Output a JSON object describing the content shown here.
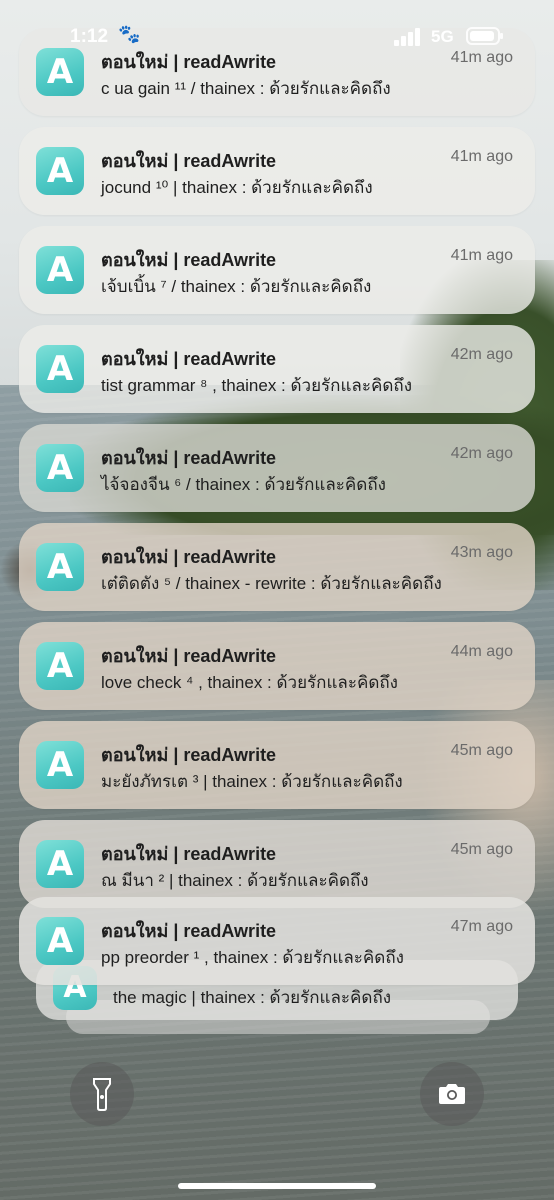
{
  "status_bar": {
    "time": "1:12",
    "network": "5G"
  },
  "notifications": [
    {
      "app": "ตอนใหม่ | readAwrite",
      "age": "41m ago",
      "message": "c ua gain ¹¹ / thainex : ด้วยรักและคิดถึง"
    },
    {
      "app": "ตอนใหม่ | readAwrite",
      "age": "41m ago",
      "message": "jocund ¹⁰  | thainex : ด้วยรักและคิดถึง"
    },
    {
      "app": "ตอนใหม่ | readAwrite",
      "age": "41m ago",
      "message": "เจ้บเบิ้น ⁷ / thainex : ด้วยรักและคิดถึง"
    },
    {
      "app": "ตอนใหม่ | readAwrite",
      "age": "42m ago",
      "message": "tist grammar ⁸ , thainex  : ด้วยรักและคิดถึง"
    },
    {
      "app": "ตอนใหม่ | readAwrite",
      "age": "42m ago",
      "message": "ไจ้จองจีน ⁶ / thainex : ด้วยรักและคิดถึง"
    },
    {
      "app": "ตอนใหม่ | readAwrite",
      "age": "43m ago",
      "message": "เต๋ติดตัง ⁵ / thainex - rewrite  : ด้วยรักและคิดถึง"
    },
    {
      "app": "ตอนใหม่ | readAwrite",
      "age": "44m ago",
      "message": "love check ⁴  ,  thainex : ด้วยรักและคิดถึง"
    },
    {
      "app": "ตอนใหม่ | readAwrite",
      "age": "45m ago",
      "message": "มะยังภัทรเต ³ | thainex  : ด้วยรักและคิดถึง"
    },
    {
      "app": "ตอนใหม่ | readAwrite",
      "age": "45m ago",
      "message": "ณ มีนา ² | thainex : ด้วยรักและคิดถึง"
    },
    {
      "app": "ตอนใหม่ | readAwrite",
      "age": "47m ago",
      "message": "pp preorder ¹ , thainex  : ด้วยรักและคิดถึง"
    }
  ],
  "stacked_notification": {
    "message": "the magic | thainex : ด้วยรักและคิดถึง"
  },
  "app_icon_letter": "A",
  "icons": {
    "flashlight": "flashlight-icon",
    "camera": "camera-icon"
  },
  "colors": {
    "app_icon": "#4cc8c4",
    "card": "#ecece9"
  }
}
